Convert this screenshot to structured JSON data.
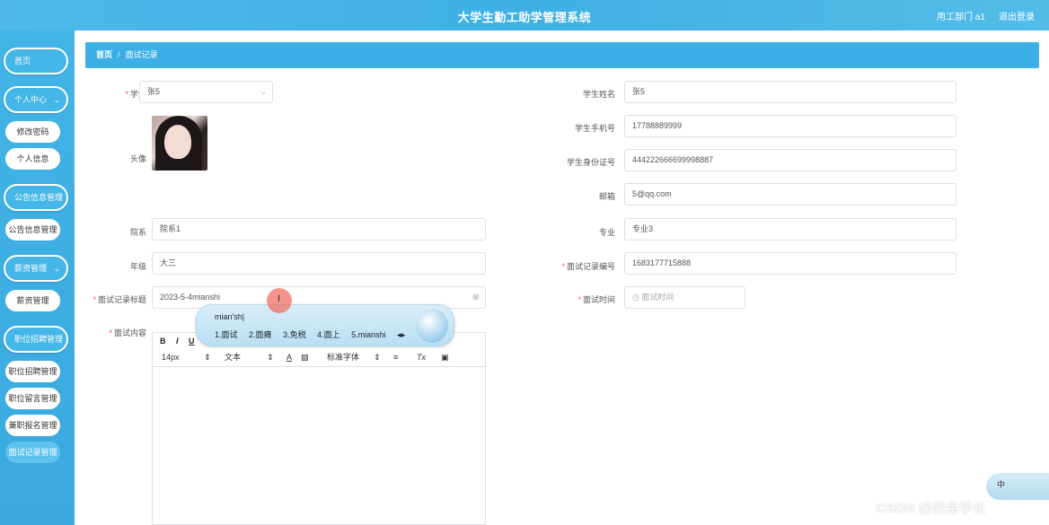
{
  "header": {
    "title": "大学生勤工助学管理系统",
    "user": "用工部门 a1",
    "logout": "退出登录"
  },
  "sidebar": {
    "home": "首页",
    "personal": {
      "label": "个人中心",
      "items": [
        "修改密码",
        "个人信息"
      ]
    },
    "notice": {
      "label": "公告信息管理",
      "items": [
        "公告信息管理"
      ]
    },
    "salary": {
      "label": "薪资管理",
      "items": [
        "薪资管理"
      ]
    },
    "jobs": {
      "label": "职位招聘管理",
      "items": [
        "职位招聘管理",
        "职位留言管理",
        "兼职报名管理",
        "面试记录管理"
      ]
    }
  },
  "breadcrumb": {
    "home": "首页",
    "separator": "/",
    "current": "面试记录"
  },
  "form": {
    "student": {
      "label": "学生",
      "value": "张5"
    },
    "student_name": {
      "label": "学生姓名",
      "value": "张5"
    },
    "avatar": {
      "label": "头像"
    },
    "phone": {
      "label": "学生手机号",
      "value": "17788889999"
    },
    "id_card": {
      "label": "学生身份证号",
      "value": "444222666699998887"
    },
    "email": {
      "label": "邮箱",
      "value": "5@qq.com"
    },
    "department": {
      "label": "院系",
      "value": "院系1"
    },
    "major": {
      "label": "专业",
      "value": "专业3"
    },
    "grade": {
      "label": "年级",
      "value": "大三"
    },
    "record_no": {
      "label": "面试记录编号",
      "value": "1683177715888"
    },
    "title": {
      "label": "面试记录标题",
      "value": "2023-5-4mianshi"
    },
    "time": {
      "label": "面试时间",
      "placeholder": "面试时间"
    },
    "content": {
      "label": "面试内容"
    }
  },
  "editor": {
    "toolbar1": [
      "B",
      "I",
      "U"
    ],
    "font_size": "14px",
    "text_style": "文本",
    "font_family": "标准字体"
  },
  "ime": {
    "composition": "mian'sh|",
    "candidates": [
      "1.面试",
      "2.面瘫",
      "3.免税",
      "4.面上",
      "5.mianshi"
    ]
  },
  "ime_status": "中",
  "watermark": "CSDN @四金学长"
}
